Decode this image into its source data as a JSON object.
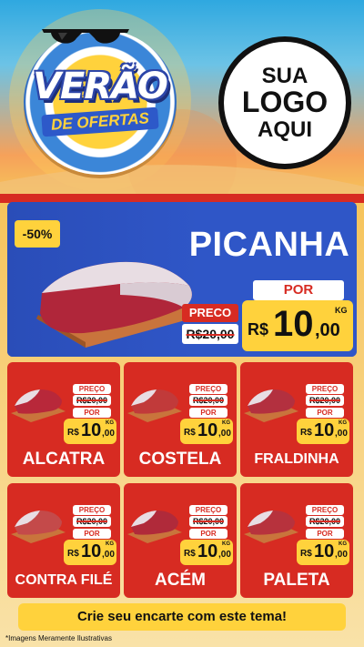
{
  "brand": {
    "verao": "VERÃO",
    "ofertas": "DE OFERTAS",
    "logo_lines": [
      "SUA",
      "LOGO",
      "AQUI"
    ]
  },
  "feature": {
    "badge": "-50%",
    "name": "PICANHA",
    "preco_label": "PRECO",
    "old_price": "R$20,00",
    "por_label": "POR",
    "currency": "R$",
    "new_int": "10",
    "new_dec": ",00",
    "unit": "KG"
  },
  "products": [
    {
      "name": "ALCATRA",
      "preco_label": "PREÇO",
      "old_price": "R$20,00",
      "por_label": "POR",
      "currency": "R$",
      "new_int": "10",
      "new_dec": ",00",
      "unit": "KG"
    },
    {
      "name": "COSTELA",
      "preco_label": "PREÇO",
      "old_price": "R$20,00",
      "por_label": "POR",
      "currency": "R$",
      "new_int": "10",
      "new_dec": ",00",
      "unit": "KG"
    },
    {
      "name": "FRALDINHA",
      "preco_label": "PREÇO",
      "old_price": "R$20,00",
      "por_label": "POR",
      "currency": "R$",
      "new_int": "10",
      "new_dec": ",00",
      "unit": "KG"
    },
    {
      "name": "CONTRA FILÉ",
      "preco_label": "PREÇO",
      "old_price": "R$20,00",
      "por_label": "POR",
      "currency": "R$",
      "new_int": "10",
      "new_dec": ",00",
      "unit": "KG"
    },
    {
      "name": "ACÉM",
      "preco_label": "PREÇO",
      "old_price": "R$20,00",
      "por_label": "POR",
      "currency": "R$",
      "new_int": "10",
      "new_dec": ",00",
      "unit": "KG"
    },
    {
      "name": "PALETA",
      "preco_label": "PREÇO",
      "old_price": "R$20,00",
      "por_label": "POR",
      "currency": "R$",
      "new_int": "10",
      "new_dec": ",00",
      "unit": "KG"
    }
  ],
  "footer": {
    "cta": "Crie seu encarte com este tema!",
    "disclaimer": "*Imagens Meramente Ilustrativas"
  },
  "colors": {
    "red": "#d72b22",
    "blue": "#2f56c7",
    "yellow": "#ffd23c"
  }
}
